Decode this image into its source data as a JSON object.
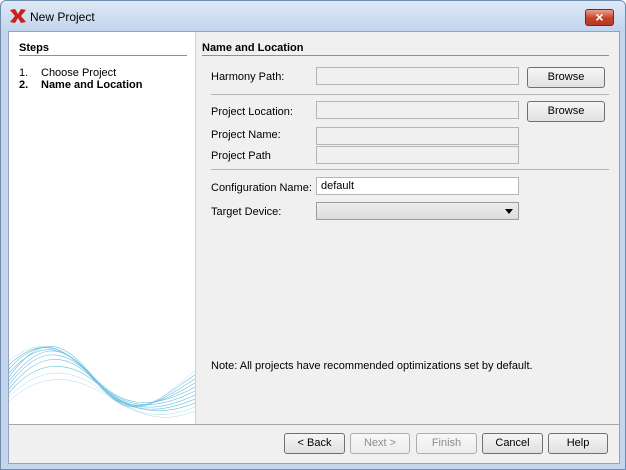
{
  "window": {
    "title": "New Project",
    "close_glyph": "×"
  },
  "steps": {
    "header": "Steps",
    "items": [
      {
        "num": "1.",
        "label": "Choose Project"
      },
      {
        "num": "2.",
        "label": "Name and Location"
      }
    ]
  },
  "form": {
    "header": "Name and Location",
    "harmony_path_label": "Harmony Path:",
    "harmony_path_value": "",
    "project_location_label": "Project Location:",
    "project_location_value": "",
    "project_name_label": "Project Name:",
    "project_name_value": "",
    "project_path_label": "Project Path",
    "project_path_value": "",
    "configuration_name_label": "Configuration Name:",
    "configuration_name_value": "default",
    "target_device_label": "Target Device:",
    "target_device_value": "",
    "browse_label": "Browse",
    "note": "Note:  All projects have recommended optimizations set by default."
  },
  "footer": {
    "back": "< Back",
    "next": "Next >",
    "finish": "Finish",
    "cancel": "Cancel",
    "help": "Help"
  },
  "icons": {
    "app": "app-logo-icon",
    "close": "close-icon",
    "dropdown": "chevron-down-icon",
    "wave": "wave-graphic"
  },
  "colors": {
    "title_bar": "#c2d4ec",
    "close_button": "#c5432b",
    "wave": "#39a9d4"
  }
}
